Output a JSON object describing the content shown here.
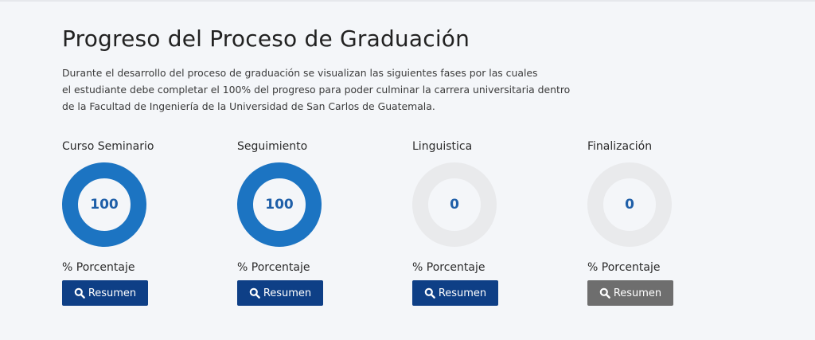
{
  "header": {
    "title": "Progreso del Proceso de Graduación",
    "description_lines": [
      "Durante el desarrollo del proceso de graduación se visualizan las siguientes fases por las cuales",
      "el estudiante debe completar el 100% del progreso para poder culminar la carrera universitaria dentro",
      "de la Facultad de Ingeniería de la Universidad de San Carlos de Guatemala."
    ]
  },
  "colors": {
    "ring_progress": "#1c74c2",
    "ring_empty": "#e9eaec",
    "button_active": "#0e3f86",
    "button_disabled": "#6e6e6e",
    "value_text": "#1f5fa8"
  },
  "phases": [
    {
      "title": "Curso Seminario",
      "value": "100",
      "progress": 1.0,
      "percent_label": "% Porcentaje",
      "button_label": "Resumen",
      "button_state": "active",
      "button_icon": "search-icon"
    },
    {
      "title": "Seguimiento",
      "value": "100",
      "progress": 1.0,
      "percent_label": "% Porcentaje",
      "button_label": "Resumen",
      "button_state": "active",
      "button_icon": "search-icon"
    },
    {
      "title": "Linguistica",
      "value": "0",
      "progress": 0.0,
      "percent_label": "% Porcentaje",
      "button_label": "Resumen",
      "button_state": "active",
      "button_icon": "search-icon"
    },
    {
      "title": "Finalización",
      "value": "0",
      "progress": 0.0,
      "percent_label": "% Porcentaje",
      "button_label": "Resumen",
      "button_state": "disabled",
      "button_icon": "search-icon"
    }
  ]
}
